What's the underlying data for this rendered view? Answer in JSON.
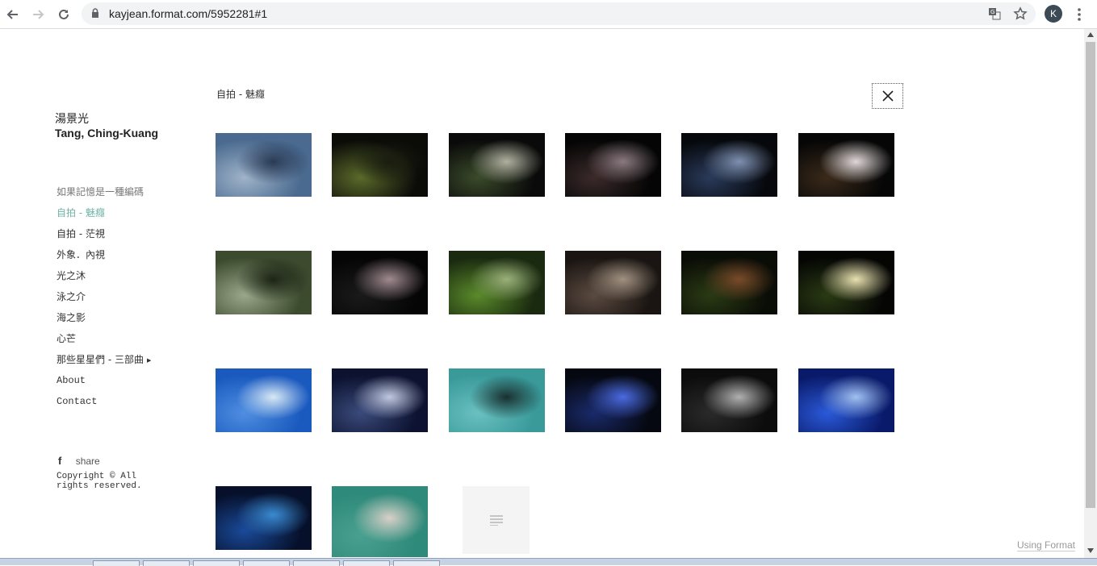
{
  "browser": {
    "url": "kayjean.format.com/5952281#1",
    "profile_initial": "K"
  },
  "sidebar": {
    "title_cn": "湯景光",
    "title_en": "Tang, Ching-Kuang",
    "items": [
      {
        "label": "如果記憶是一種編碼",
        "state": "muted"
      },
      {
        "label": "自拍 - 魅癮",
        "state": "active"
      },
      {
        "label": "自拍 - 茫視",
        "state": "normal"
      },
      {
        "label": "外象．內視",
        "state": "normal"
      },
      {
        "label": "光之沐",
        "state": "normal"
      },
      {
        "label": "泳之介",
        "state": "normal"
      },
      {
        "label": "海之影",
        "state": "normal"
      },
      {
        "label": "心芒",
        "state": "normal"
      },
      {
        "label": "那些星星們 - 三部曲",
        "state": "normal",
        "has_submenu": true
      },
      {
        "label": "About",
        "state": "mono"
      },
      {
        "label": "Contact",
        "state": "mono"
      }
    ],
    "share_label": "share",
    "copyright": "Copyright © All rights reserved."
  },
  "gallery": {
    "title": "自拍 - 魅癮",
    "thumbnails": [
      {
        "name": "photo-1",
        "colors": [
          "#4a6a8f",
          "#9fb3c9",
          "#2a3a55"
        ]
      },
      {
        "name": "photo-2",
        "colors": [
          "#0b0b08",
          "#5a6a2a",
          "#1b1e10"
        ]
      },
      {
        "name": "photo-3",
        "colors": [
          "#0a0a0a",
          "#3a4a2a",
          "#b0b0a0"
        ]
      },
      {
        "name": "photo-4",
        "colors": [
          "#050505",
          "#3b2a2a",
          "#8a7a80"
        ]
      },
      {
        "name": "photo-5",
        "colors": [
          "#06080c",
          "#2a3a5a",
          "#7e90b0"
        ]
      },
      {
        "name": "photo-6",
        "colors": [
          "#060606",
          "#3a2a1a",
          "#e0d8d8"
        ]
      },
      {
        "name": "photo-7",
        "colors": [
          "#3c4a2e",
          "#9aa78a",
          "#1c2414"
        ]
      },
      {
        "name": "photo-8",
        "colors": [
          "#050505",
          "#1a1a1a",
          "#a08a90"
        ]
      },
      {
        "name": "photo-9",
        "colors": [
          "#1a2a10",
          "#5a8a2a",
          "#9ab07a"
        ]
      },
      {
        "name": "photo-10",
        "colors": [
          "#1a1512",
          "#5a4a40",
          "#a09080"
        ]
      },
      {
        "name": "photo-11",
        "colors": [
          "#0a0d06",
          "#2a3a14",
          "#7a4a2a"
        ]
      },
      {
        "name": "photo-12",
        "colors": [
          "#050604",
          "#2a3a14",
          "#e8e0b0"
        ]
      },
      {
        "name": "photo-13",
        "colors": [
          "#1a5abf",
          "#4f8ee0",
          "#d8e8f5"
        ]
      },
      {
        "name": "photo-14",
        "colors": [
          "#0c1230",
          "#3a4a7a",
          "#c0c8e0"
        ]
      },
      {
        "name": "photo-15",
        "colors": [
          "#3a9a9a",
          "#6ac0c0",
          "#1a3030"
        ]
      },
      {
        "name": "photo-16",
        "colors": [
          "#050810",
          "#1a2a6a",
          "#4a6ae0"
        ]
      },
      {
        "name": "photo-17",
        "colors": [
          "#0c0c0c",
          "#2a2a2a",
          "#b0b0b0"
        ]
      },
      {
        "name": "photo-18",
        "colors": [
          "#0a1a6a",
          "#2a5ad8",
          "#a0c0f0"
        ]
      },
      {
        "name": "photo-19",
        "colors": [
          "#06102a",
          "#1a4a9a",
          "#3a8ad0"
        ]
      },
      {
        "name": "photo-20",
        "colors": [
          "#2e8a7a",
          "#4aa090",
          "#d8d0c8"
        ]
      }
    ]
  },
  "footer": {
    "using_format": "Using Format"
  },
  "colors": {
    "accent": "#6fb3a4"
  }
}
